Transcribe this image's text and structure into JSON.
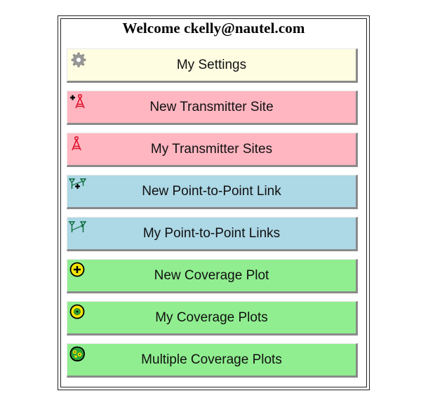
{
  "header": {
    "title": "Welcome ckelly@nautel.com"
  },
  "colors": {
    "settings": "#fffde1",
    "transmitter": "#ffb6c1",
    "link": "#add8e6",
    "coverage": "#90ee90"
  },
  "menu": [
    {
      "label": "My Settings",
      "icon": "gear-icon",
      "color": "#fffde1"
    },
    {
      "label": "New Transmitter Site",
      "icon": "add-transmitter-icon",
      "color": "#ffb6c1"
    },
    {
      "label": "My Transmitter Sites",
      "icon": "transmitter-icon",
      "color": "#ffb6c1"
    },
    {
      "label": "New Point-to-Point Link",
      "icon": "add-link-icon",
      "color": "#add8e6"
    },
    {
      "label": "My Point-to-Point Links",
      "icon": "link-icon",
      "color": "#add8e6"
    },
    {
      "label": "New Coverage Plot",
      "icon": "add-coverage-icon",
      "color": "#90ee90"
    },
    {
      "label": "My Coverage Plots",
      "icon": "coverage-icon",
      "color": "#90ee90"
    },
    {
      "label": "Multiple Coverage Plots",
      "icon": "multi-coverage-icon",
      "color": "#90ee90"
    }
  ]
}
